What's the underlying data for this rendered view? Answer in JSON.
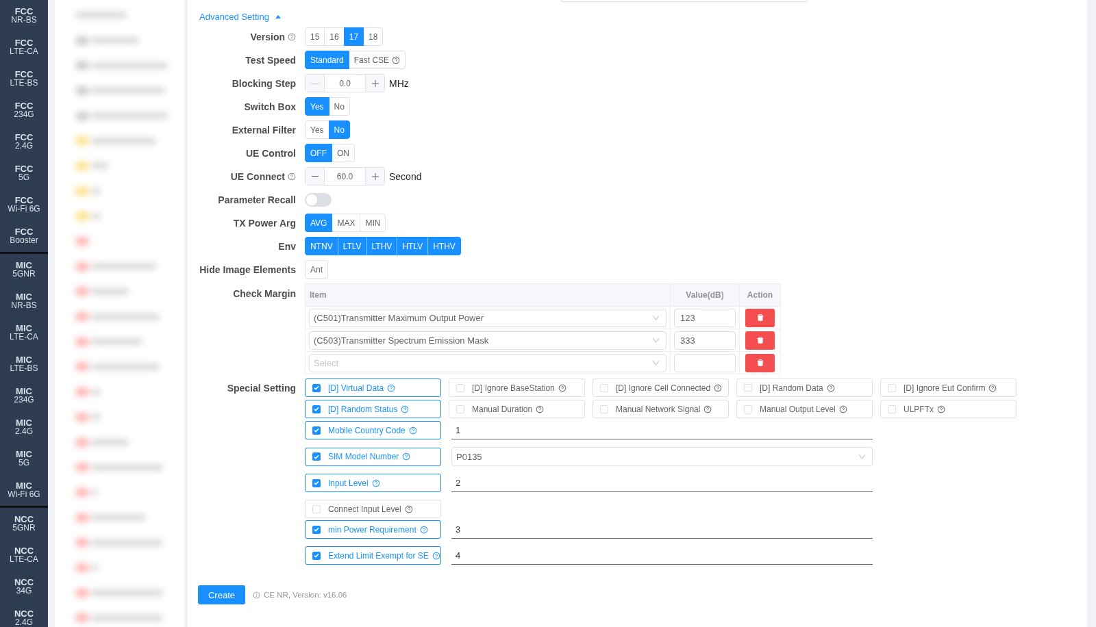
{
  "sidebar": {
    "groups": [
      {
        "items": [
          {
            "title": "FCC",
            "band": "NR-BS"
          },
          {
            "title": "FCC",
            "band": "LTE-CA"
          },
          {
            "title": "FCC",
            "band": "LTE-BS"
          },
          {
            "title": "FCC",
            "band": "234G"
          },
          {
            "title": "FCC",
            "band": "2.4G"
          },
          {
            "title": "FCC",
            "band": "5G"
          },
          {
            "title": "FCC",
            "band": "Wi-Fi 6G"
          },
          {
            "title": "FCC",
            "band": "Booster"
          }
        ]
      },
      {
        "items": [
          {
            "title": "MIC",
            "band": "5GNR"
          },
          {
            "title": "MIC",
            "band": "NR-BS"
          },
          {
            "title": "MIC",
            "band": "LTE-CA"
          },
          {
            "title": "MIC",
            "band": "LTE-BS"
          },
          {
            "title": "MIC",
            "band": "234G"
          },
          {
            "title": "MIC",
            "band": "2.4G"
          },
          {
            "title": "MIC",
            "band": "5G"
          },
          {
            "title": "MIC",
            "band": "Wi-Fi 6G"
          }
        ]
      },
      {
        "items": [
          {
            "title": "NCC",
            "band": "5GNR"
          },
          {
            "title": "NCC",
            "band": "LTE-CA"
          },
          {
            "title": "NCC",
            "band": "34G"
          },
          {
            "title": "NCC",
            "band": "2.4G"
          }
        ]
      }
    ]
  },
  "advanced_setting": {
    "label": "Advanced Setting",
    "expanded": true
  },
  "form": {
    "rows": [
      {
        "kind": "segmented",
        "label": "Version",
        "help": true,
        "options": [
          {
            "label": "15",
            "help": false,
            "selected": false
          },
          {
            "label": "16",
            "help": false,
            "selected": false
          },
          {
            "label": "17",
            "help": false,
            "selected": true
          },
          {
            "label": "18",
            "help": false,
            "selected": false
          }
        ]
      },
      {
        "kind": "segmented",
        "label": "Test Speed",
        "help": false,
        "options": [
          {
            "label": "Standard",
            "help": false,
            "selected": true
          },
          {
            "label": "Fast CSE",
            "help": true,
            "selected": false
          }
        ]
      },
      {
        "kind": "stepper",
        "label": "Blocking Step",
        "help": false,
        "value": "0.0",
        "unit": "MHz",
        "minus_disabled": true
      },
      {
        "kind": "segmented",
        "label": "Switch Box",
        "help": false,
        "options": [
          {
            "label": "Yes",
            "help": false,
            "selected": true
          },
          {
            "label": "No",
            "help": false,
            "selected": false
          }
        ]
      },
      {
        "kind": "segmented",
        "label": "External Filter",
        "help": false,
        "options": [
          {
            "label": "Yes",
            "help": false,
            "selected": false
          },
          {
            "label": "No",
            "help": false,
            "selected": true
          }
        ]
      },
      {
        "kind": "segmented",
        "label": "UE Control",
        "help": false,
        "options": [
          {
            "label": "OFF",
            "help": false,
            "selected": true
          },
          {
            "label": "ON",
            "help": false,
            "selected": false
          }
        ]
      },
      {
        "kind": "stepper",
        "label": "UE Connect",
        "help": true,
        "value": "60.0",
        "unit": "Second",
        "minus_disabled": false
      },
      {
        "kind": "switch",
        "label": "Parameter Recall",
        "help": false,
        "on": false
      },
      {
        "kind": "segmented",
        "label": "TX Power Arg",
        "help": false,
        "options": [
          {
            "label": "AVG",
            "help": false,
            "selected": true
          },
          {
            "label": "MAX",
            "help": false,
            "selected": false
          },
          {
            "label": "MIN",
            "help": false,
            "selected": false
          }
        ]
      },
      {
        "kind": "segmented",
        "label": "Env",
        "help": false,
        "options": [
          {
            "label": "NTNV",
            "help": false,
            "selected": true
          },
          {
            "label": "LTLV",
            "help": false,
            "selected": true
          },
          {
            "label": "LTHV",
            "help": false,
            "selected": true
          },
          {
            "label": "HTLV",
            "help": false,
            "selected": true
          },
          {
            "label": "HTHV",
            "help": false,
            "selected": true
          }
        ]
      },
      {
        "kind": "segmented",
        "label": "Hide Image Elements",
        "help": false,
        "options": [
          {
            "label": "Ant",
            "help": false,
            "selected": false
          }
        ]
      },
      {
        "kind": "table",
        "label": "Check Margin",
        "help": false,
        "columns": [
          "Item",
          "Value(dB)",
          "Action"
        ],
        "rows": [
          {
            "item": "(C501)Transmitter Maximum Output Power",
            "value": "123"
          },
          {
            "item": "(C503)Transmitter Spectrum Emission Mask",
            "value": "333"
          },
          {
            "placeholder": "Select"
          }
        ]
      }
    ]
  },
  "special_setting": {
    "label": "Special Setting",
    "options": [
      {
        "label": "[D] Virtual Data",
        "checked": true,
        "help": true
      },
      {
        "label": "[D] Ignore BaseStation",
        "checked": false,
        "help": true
      },
      {
        "label": "[D] Ignore Cell Connected",
        "checked": false,
        "help": true
      },
      {
        "label": "[D] Random Data",
        "checked": false,
        "help": true
      },
      {
        "label": "[D] Ignore Eut Confirm",
        "checked": false,
        "help": true
      },
      {
        "label": "[D] Random Status",
        "checked": true,
        "help": true
      },
      {
        "label": "Manual Duration",
        "checked": false,
        "help": true
      },
      {
        "label": "Manual Network Signal",
        "checked": false,
        "help": true
      },
      {
        "label": "Manual Output Level",
        "checked": false,
        "help": true
      },
      {
        "label": "ULPFTx",
        "checked": false,
        "help": true
      }
    ],
    "fields": [
      {
        "label": "Mobile Country Code",
        "checked": true,
        "help": true,
        "input": {
          "kind": "line",
          "value": "1"
        }
      },
      {
        "label": "SIM Model Number",
        "checked": true,
        "help": true,
        "input": {
          "kind": "select",
          "value": "P0135"
        }
      },
      {
        "label": "Input Level",
        "checked": true,
        "help": true,
        "input": {
          "kind": "line",
          "value": "2"
        }
      },
      {
        "label": "Connect Input Level",
        "checked": false,
        "help": true
      },
      {
        "label": "min Power Requirement",
        "checked": true,
        "help": true,
        "input": {
          "kind": "line",
          "value": "3"
        }
      },
      {
        "label": "Extend Limit Exempt for SE",
        "checked": true,
        "help": true,
        "input": {
          "kind": "line",
          "value": "4"
        }
      }
    ]
  },
  "footer": {
    "button": "Create",
    "info": "CE NR, Version: v16.06"
  }
}
